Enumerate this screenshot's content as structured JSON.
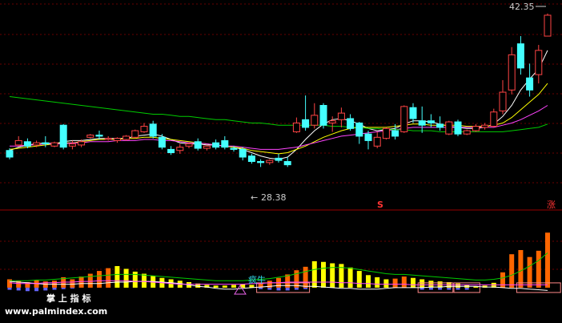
{
  "chart_data": {
    "type": "candlestick",
    "price_axis": {
      "min": 25.0,
      "max": 43.0
    },
    "annotations": {
      "high_label": "42.35",
      "low_label": "28.38",
      "low_prefix": "←",
      "s_marker": "S",
      "zhang_marker": "涨",
      "signal_text": "疯牛",
      "watermark_cn": "掌 上 指 标",
      "watermark_url": "www.palmindex.com"
    },
    "candles": [
      {
        "o": 29.9,
        "h": 30.1,
        "c": 29.3,
        "l": 29.1,
        "up": false
      },
      {
        "o": 30.4,
        "h": 31.2,
        "c": 30.8,
        "l": 30.3,
        "up": true
      },
      {
        "o": 30.7,
        "h": 31.0,
        "c": 30.3,
        "l": 30.1,
        "up": false
      },
      {
        "o": 30.4,
        "h": 30.8,
        "c": 30.6,
        "l": 30.2,
        "up": true
      },
      {
        "o": 30.6,
        "h": 31.2,
        "c": 30.5,
        "l": 30.2,
        "up": false
      },
      {
        "o": 30.3,
        "h": 30.7,
        "c": 30.6,
        "l": 30.2,
        "up": true
      },
      {
        "o": 30.2,
        "h": 32.3,
        "c": 32.2,
        "l": 30.0,
        "up": false
      },
      {
        "o": 30.3,
        "h": 30.8,
        "c": 30.5,
        "l": 30.0,
        "up": true
      },
      {
        "o": 30.4,
        "h": 30.9,
        "c": 30.7,
        "l": 30.2,
        "up": true
      },
      {
        "o": 31.1,
        "h": 31.4,
        "c": 31.3,
        "l": 31.0,
        "up": true
      },
      {
        "o": 31.3,
        "h": 31.7,
        "c": 31.2,
        "l": 30.9,
        "up": false
      },
      {
        "o": 30.9,
        "h": 31.2,
        "c": 31.0,
        "l": 30.8,
        "up": true
      },
      {
        "o": 30.8,
        "h": 31.1,
        "c": 31.0,
        "l": 30.6,
        "up": true
      },
      {
        "o": 30.9,
        "h": 31.3,
        "c": 31.2,
        "l": 30.8,
        "up": true
      },
      {
        "o": 31.1,
        "h": 31.8,
        "c": 31.7,
        "l": 31.0,
        "up": true
      },
      {
        "o": 31.6,
        "h": 32.4,
        "c": 32.1,
        "l": 31.5,
        "up": true
      },
      {
        "o": 32.3,
        "h": 32.6,
        "c": 31.2,
        "l": 31.0,
        "up": false
      },
      {
        "o": 31.1,
        "h": 31.4,
        "c": 30.2,
        "l": 30.0,
        "up": false
      },
      {
        "o": 30.0,
        "h": 30.3,
        "c": 29.7,
        "l": 29.5,
        "up": false
      },
      {
        "o": 29.9,
        "h": 30.5,
        "c": 30.2,
        "l": 29.6,
        "up": true
      },
      {
        "o": 30.3,
        "h": 30.6,
        "c": 30.5,
        "l": 30.1,
        "up": true
      },
      {
        "o": 30.7,
        "h": 31.0,
        "c": 30.1,
        "l": 29.9,
        "up": false
      },
      {
        "o": 30.1,
        "h": 30.4,
        "c": 30.3,
        "l": 29.9,
        "up": true
      },
      {
        "o": 30.6,
        "h": 30.9,
        "c": 30.2,
        "l": 30.0,
        "up": false
      },
      {
        "o": 30.8,
        "h": 31.2,
        "c": 30.2,
        "l": 30.0,
        "up": false
      },
      {
        "o": 30.1,
        "h": 30.3,
        "c": 30.0,
        "l": 29.8,
        "up": false
      },
      {
        "o": 30.0,
        "h": 30.2,
        "c": 29.3,
        "l": 29.0,
        "up": false
      },
      {
        "o": 29.4,
        "h": 29.6,
        "c": 28.9,
        "l": 28.7,
        "up": false
      },
      {
        "o": 28.9,
        "h": 29.1,
        "c": 28.8,
        "l": 28.4,
        "up": false
      },
      {
        "o": 28.8,
        "h": 29.1,
        "c": 29.0,
        "l": 28.6,
        "up": true
      },
      {
        "o": 29.2,
        "h": 29.6,
        "c": 29.0,
        "l": 28.8,
        "up": false
      },
      {
        "o": 28.9,
        "h": 29.3,
        "c": 28.6,
        "l": 28.4,
        "up": false
      },
      {
        "o": 31.6,
        "h": 32.9,
        "c": 32.4,
        "l": 31.5,
        "up": true
      },
      {
        "o": 32.0,
        "h": 34.9,
        "c": 32.7,
        "l": 31.7,
        "up": false
      },
      {
        "o": 32.2,
        "h": 34.2,
        "c": 33.1,
        "l": 31.9,
        "up": true
      },
      {
        "o": 34.0,
        "h": 34.2,
        "c": 32.2,
        "l": 31.9,
        "up": false
      },
      {
        "o": 32.4,
        "h": 33.0,
        "c": 32.6,
        "l": 31.6,
        "up": true
      },
      {
        "o": 32.7,
        "h": 33.8,
        "c": 33.3,
        "l": 32.0,
        "up": true
      },
      {
        "o": 32.8,
        "h": 33.2,
        "c": 31.9,
        "l": 31.7,
        "up": false
      },
      {
        "o": 32.4,
        "h": 32.5,
        "c": 31.2,
        "l": 30.5,
        "up": false
      },
      {
        "o": 31.4,
        "h": 31.7,
        "c": 30.8,
        "l": 30.0,
        "up": false
      },
      {
        "o": 30.3,
        "h": 31.6,
        "c": 31.1,
        "l": 30.1,
        "up": true
      },
      {
        "o": 31.0,
        "h": 32.0,
        "c": 31.9,
        "l": 30.9,
        "up": true
      },
      {
        "o": 31.7,
        "h": 32.3,
        "c": 31.2,
        "l": 30.9,
        "up": false
      },
      {
        "o": 31.6,
        "h": 34.0,
        "c": 33.9,
        "l": 31.5,
        "up": true
      },
      {
        "o": 33.8,
        "h": 34.2,
        "c": 32.8,
        "l": 32.4,
        "up": false
      },
      {
        "o": 32.2,
        "h": 33.9,
        "c": 32.6,
        "l": 31.5,
        "up": false
      },
      {
        "o": 32.6,
        "h": 33.2,
        "c": 32.4,
        "l": 32.0,
        "up": false
      },
      {
        "o": 32.3,
        "h": 33.0,
        "c": 32.0,
        "l": 31.7,
        "up": false
      },
      {
        "o": 31.4,
        "h": 32.6,
        "c": 32.5,
        "l": 31.3,
        "up": true
      },
      {
        "o": 32.5,
        "h": 32.7,
        "c": 31.4,
        "l": 31.2,
        "up": false
      },
      {
        "o": 31.4,
        "h": 31.8,
        "c": 31.7,
        "l": 31.3,
        "up": true
      },
      {
        "o": 31.7,
        "h": 32.3,
        "c": 32.1,
        "l": 31.6,
        "up": true
      },
      {
        "o": 32.0,
        "h": 32.4,
        "c": 32.2,
        "l": 31.8,
        "up": true
      },
      {
        "o": 32.1,
        "h": 33.7,
        "c": 33.4,
        "l": 32.0,
        "up": true
      },
      {
        "o": 33.5,
        "h": 36.3,
        "c": 35.2,
        "l": 33.2,
        "up": true
      },
      {
        "o": 35.4,
        "h": 39.3,
        "c": 38.6,
        "l": 35.0,
        "up": true
      },
      {
        "o": 39.6,
        "h": 40.3,
        "c": 37.4,
        "l": 36.8,
        "up": false
      },
      {
        "o": 35.4,
        "h": 37.8,
        "c": 36.5,
        "l": 34.8,
        "up": false
      },
      {
        "o": 36.8,
        "h": 39.5,
        "c": 39.0,
        "l": 36.0,
        "up": true
      },
      {
        "o": 40.3,
        "h": 42.35,
        "c": 42.2,
        "l": 40.3,
        "up": true
      }
    ],
    "ma_lines": [
      {
        "name": "MA5",
        "color": "#ffffff",
        "values": [
          29.9,
          30.2,
          30.4,
          30.5,
          30.6,
          30.5,
          30.7,
          30.8,
          30.8,
          30.9,
          31.0,
          31.0,
          31.0,
          31.0,
          31.2,
          31.3,
          31.4,
          31.2,
          30.9,
          30.6,
          30.5,
          30.5,
          30.4,
          30.4,
          30.3,
          30.2,
          30.0,
          29.7,
          29.4,
          29.2,
          29.1,
          29.3,
          30.0,
          30.9,
          31.7,
          32.3,
          32.7,
          32.8,
          32.6,
          32.3,
          31.9,
          31.7,
          31.8,
          31.9,
          32.3,
          32.6,
          32.6,
          32.5,
          32.3,
          32.1,
          32.0,
          31.9,
          31.9,
          32.0,
          32.3,
          33.0,
          34.0,
          35.4,
          36.4,
          37.3,
          39.0
        ]
      },
      {
        "name": "MA10",
        "color": "#ffff00",
        "values": [
          30.0,
          30.1,
          30.2,
          30.3,
          30.4,
          30.5,
          30.6,
          30.6,
          30.7,
          30.8,
          30.9,
          30.9,
          30.9,
          31.0,
          31.0,
          31.1,
          31.1,
          31.0,
          30.9,
          30.8,
          30.7,
          30.6,
          30.5,
          30.4,
          30.3,
          30.2,
          30.1,
          29.9,
          29.8,
          29.7,
          29.6,
          29.7,
          30.0,
          30.3,
          30.7,
          31.1,
          31.4,
          31.7,
          31.9,
          32.0,
          32.0,
          32.0,
          32.0,
          32.1,
          32.2,
          32.3,
          32.3,
          32.2,
          32.2,
          32.2,
          32.2,
          32.1,
          32.1,
          32.1,
          32.2,
          32.4,
          32.9,
          33.6,
          34.3,
          35.0,
          36.0
        ]
      },
      {
        "name": "MA20",
        "color": "#ff44ff",
        "values": [
          30.3,
          30.3,
          30.4,
          30.4,
          30.5,
          30.5,
          30.5,
          30.6,
          30.6,
          30.7,
          30.7,
          30.7,
          30.8,
          30.8,
          30.8,
          30.9,
          30.9,
          30.8,
          30.8,
          30.7,
          30.6,
          30.6,
          30.5,
          30.4,
          30.3,
          30.3,
          30.2,
          30.1,
          30.0,
          30.0,
          30.0,
          30.1,
          30.2,
          30.4,
          30.6,
          30.8,
          31.0,
          31.2,
          31.3,
          31.4,
          31.5,
          31.6,
          31.7,
          31.8,
          31.9,
          32.0,
          32.0,
          32.0,
          32.0,
          32.0,
          32.0,
          32.0,
          32.0,
          32.0,
          32.0,
          32.2,
          32.4,
          32.7,
          33.1,
          33.5,
          34.0
        ]
      },
      {
        "name": "MA60",
        "color": "#00cc00",
        "values": [
          34.8,
          34.7,
          34.6,
          34.5,
          34.4,
          34.3,
          34.2,
          34.1,
          34.0,
          33.9,
          33.8,
          33.7,
          33.6,
          33.5,
          33.4,
          33.3,
          33.2,
          33.2,
          33.1,
          33.0,
          33.0,
          32.9,
          32.8,
          32.7,
          32.7,
          32.6,
          32.5,
          32.4,
          32.4,
          32.3,
          32.2,
          32.2,
          32.2,
          32.2,
          32.2,
          32.2,
          32.1,
          32.1,
          32.0,
          32.0,
          31.9,
          31.9,
          31.8,
          31.8,
          31.8,
          31.7,
          31.7,
          31.7,
          31.6,
          31.6,
          31.6,
          31.6,
          31.6,
          31.6,
          31.6,
          31.6,
          31.7,
          31.8,
          31.9,
          32.0,
          32.3
        ]
      }
    ],
    "indicator": {
      "axis": {
        "min": -3,
        "max": 10
      },
      "bars": [
        1.2,
        1.0,
        0.8,
        1.1,
        0.9,
        1.0,
        1.5,
        1.2,
        1.6,
        2.0,
        2.4,
        2.8,
        3.1,
        2.7,
        2.3,
        2.0,
        1.7,
        1.4,
        1.2,
        1.0,
        0.8,
        0.6,
        0.4,
        0.3,
        0.3,
        0.4,
        0.5,
        0.4,
        0.6,
        1.0,
        1.4,
        1.9,
        2.5,
        3.0,
        3.8,
        3.7,
        3.5,
        3.4,
        2.9,
        2.4,
        1.8,
        1.5,
        1.2,
        1.3,
        1.6,
        1.4,
        1.2,
        1.0,
        0.9,
        0.8,
        0.6,
        0.4,
        0.2,
        0.3,
        0.7,
        2.2,
        4.8,
        5.4,
        4.4,
        5.3,
        7.9
      ],
      "bar_colors": [
        "#ff6600",
        "#ff6600",
        "#ff6600",
        "#ff6600",
        "#ff6600",
        "#ff6600",
        "#ff6600",
        "#ff6600",
        "#ff6600",
        "#ff6600",
        "#ff6600",
        "#ff6600",
        "#ffff00",
        "#ffff00",
        "#ffff00",
        "#ffff00",
        "#ffff00",
        "#ffff00",
        "#ffff00",
        "#ffff00",
        "#ffff00",
        "#ffff00",
        "#ffff00",
        "#ffff00",
        "#ffff00",
        "#ffff00",
        "#ffff00",
        "#ffff00",
        "#ff6600",
        "#ff6600",
        "#ff6600",
        "#ff6600",
        "#ff6600",
        "#ff6600",
        "#ffff00",
        "#ffff00",
        "#ffff00",
        "#ffff00",
        "#ffff00",
        "#ffff00",
        "#ffff00",
        "#ffff00",
        "#ffff00",
        "#ff6600",
        "#ff6600",
        "#ffff00",
        "#ffff00",
        "#ffff00",
        "#ffff00",
        "#ffff00",
        "#ffff00",
        "#ffff00",
        "#ffff00",
        "#ffff00",
        "#ffff00",
        "#ff6600",
        "#ff6600",
        "#ff6600",
        "#ff6600",
        "#ff6600",
        "#ff6600"
      ],
      "lines": [
        {
          "name": "L1",
          "color": "#ffffff",
          "values": [
            0.9,
            0.8,
            0.7,
            0.6,
            0.5,
            0.5,
            0.5,
            0.5,
            0.6,
            0.6,
            0.6,
            0.7,
            0.8,
            0.8,
            0.9,
            0.9,
            0.9,
            0.8,
            0.7,
            0.6,
            0.4,
            0.2,
            0.1,
            -0.1,
            -0.2,
            -0.2,
            -0.1,
            0.0,
            0.1,
            0.2,
            0.3,
            0.3,
            0.3,
            0.2,
            0.2,
            0.1,
            0.0,
            -0.1,
            -0.1,
            -0.2,
            -0.2,
            -0.2,
            -0.1,
            0.0,
            0.0,
            0.0,
            0.0,
            0.1,
            0.1,
            0.2,
            0.2,
            0.2,
            0.2,
            0.1,
            0.1,
            0.0,
            -0.1,
            -0.1,
            -0.2,
            -0.3,
            -0.4
          ]
        },
        {
          "name": "L2",
          "color": "#00cc00",
          "values": [
            1.0,
            1.0,
            1.0,
            1.1,
            1.1,
            1.2,
            1.3,
            1.4,
            1.5,
            1.6,
            1.7,
            1.8,
            1.9,
            1.9,
            1.9,
            1.8,
            1.7,
            1.6,
            1.5,
            1.4,
            1.3,
            1.2,
            1.1,
            1.0,
            1.0,
            1.0,
            1.0,
            1.1,
            1.2,
            1.3,
            1.5,
            1.7,
            2.0,
            2.3,
            2.6,
            2.8,
            2.9,
            2.9,
            2.8,
            2.6,
            2.4,
            2.2,
            2.0,
            1.9,
            1.9,
            1.8,
            1.7,
            1.6,
            1.5,
            1.4,
            1.3,
            1.2,
            1.1,
            1.1,
            1.2,
            1.4,
            1.8,
            2.4,
            3.1,
            3.9,
            5.0
          ]
        },
        {
          "name": "L3",
          "color": "#ff44ff",
          "values": [
            0.7,
            0.6,
            0.6,
            0.6,
            0.7,
            0.7,
            0.8,
            0.8,
            0.9,
            0.9,
            1.0,
            1.0,
            1.0,
            1.0,
            0.9,
            0.9,
            0.8,
            0.7,
            0.6,
            0.5,
            0.5,
            0.5,
            0.5,
            0.5,
            0.5,
            0.5,
            0.5,
            0.6,
            0.6,
            0.7,
            0.7,
            0.8,
            0.8,
            0.8,
            0.8,
            0.8,
            0.8,
            0.7,
            0.7,
            0.6,
            0.6,
            0.5,
            0.5,
            0.5,
            0.5,
            0.4,
            0.4,
            0.4,
            0.4,
            0.4,
            0.4,
            0.4,
            0.4,
            0.4,
            0.4,
            0.4,
            0.4,
            0.4,
            0.4,
            0.4,
            0.4
          ]
        }
      ],
      "neg_bars": [
        0.3,
        0.4,
        0.5,
        0.5,
        0.4,
        0.3,
        0.2,
        0.1,
        0,
        0,
        0,
        0,
        0,
        0,
        0,
        0,
        0,
        0,
        0,
        0,
        0,
        0,
        0,
        0,
        0,
        0,
        0,
        0,
        0.2,
        0.3,
        0.4,
        0.4,
        0.3,
        0.2,
        0,
        0,
        0,
        0,
        0,
        0,
        0,
        0,
        0,
        0,
        0,
        0,
        0.3,
        0.3,
        0.3,
        0.3,
        0.3,
        0.3,
        0,
        0,
        0,
        0,
        0,
        0,
        0,
        0,
        0
      ],
      "boxes": [
        [
          28,
          33
        ],
        [
          46,
          49
        ],
        [
          50,
          52
        ],
        [
          57,
          61
        ]
      ]
    }
  }
}
